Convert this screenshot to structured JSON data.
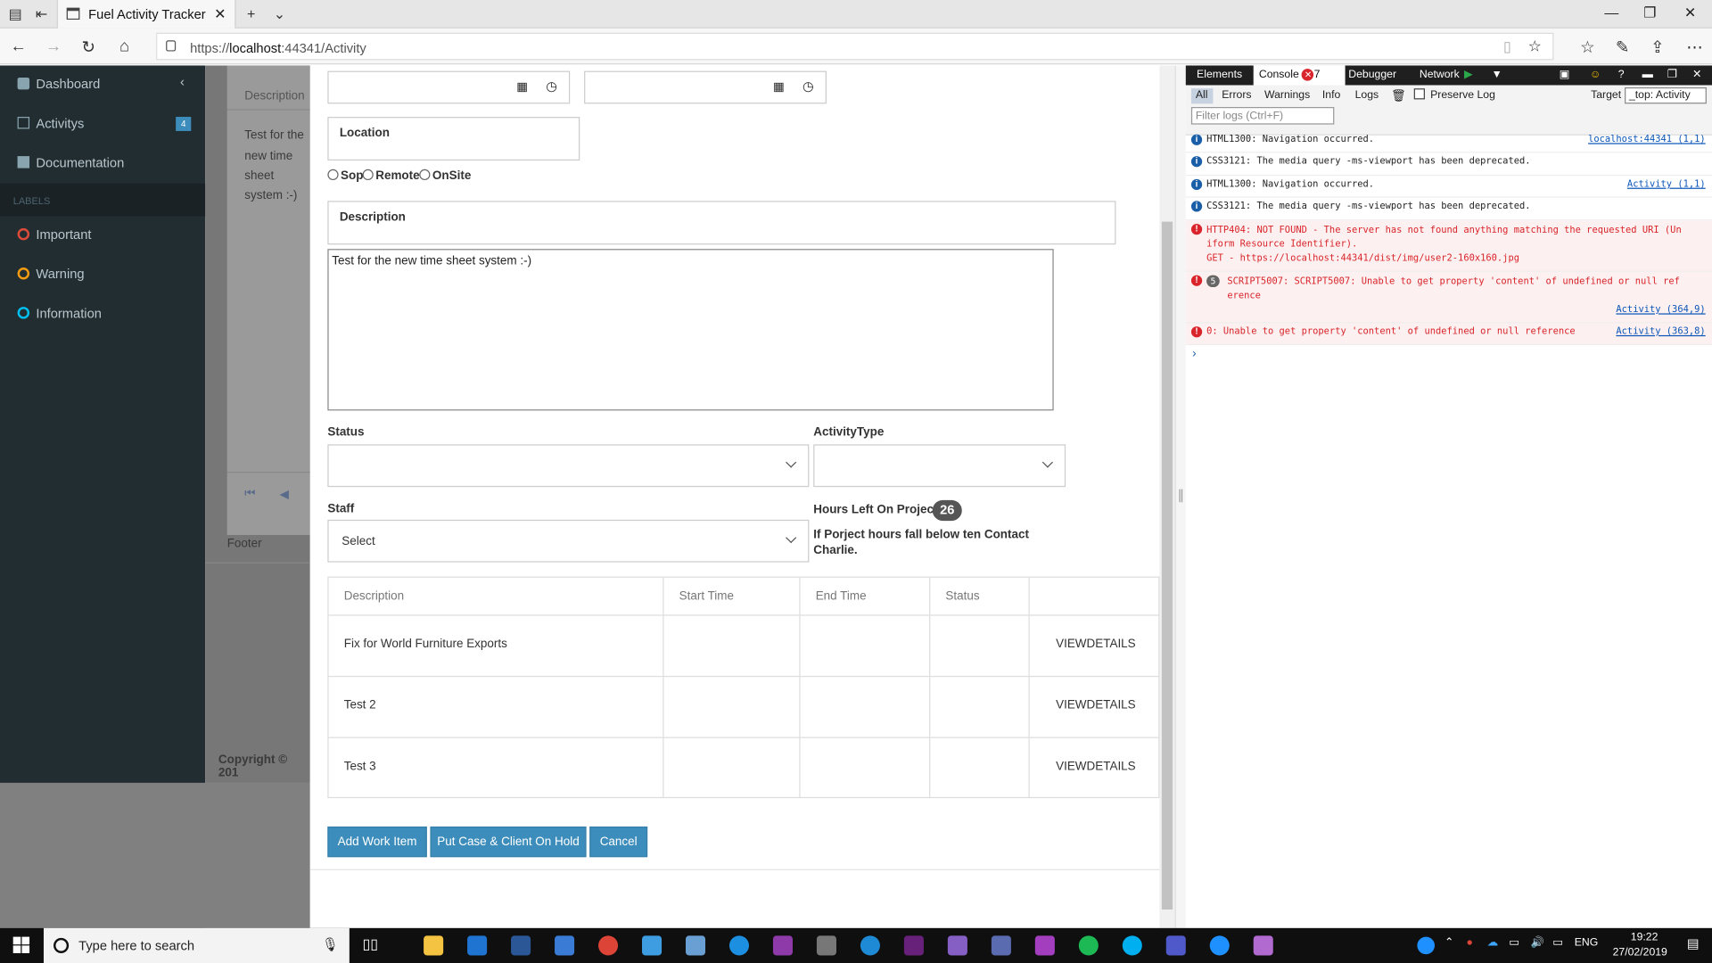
{
  "browser": {
    "tab_title": "Fuel Activity Tracker",
    "url_prefix": "https://",
    "url_host": "localhost",
    "url_rest": ":44341/Activity"
  },
  "sidebar": {
    "items": [
      {
        "label": "Dashboard"
      },
      {
        "label": "Activitys",
        "badge": "4"
      },
      {
        "label": "Documentation"
      }
    ],
    "labels_header": "LABELS",
    "labels": [
      {
        "label": "Important",
        "color": "#dd4b39"
      },
      {
        "label": "Warning",
        "color": "#f39c12"
      },
      {
        "label": "Information",
        "color": "#00c0ef"
      }
    ]
  },
  "background_page": {
    "description_header": "Description",
    "description_text": [
      "Test for the",
      "new time",
      "sheet",
      "system :-)"
    ],
    "footer": "Footer",
    "copyright": "Copyright © 201"
  },
  "form": {
    "location_label": "Location",
    "location_options": [
      "Sop",
      "Remote",
      "OnSite"
    ],
    "description_label": "Description",
    "description_value": "Test for the new time sheet system :-)",
    "status_label": "Status",
    "activity_type_label": "ActivityType",
    "staff_label": "Staff",
    "staff_value": "Select",
    "hours_left_label": "Hours Left On Project",
    "hours_left_value": "26",
    "hours_warning": "If Porject hours fall below ten Contact Charlie."
  },
  "work_items_table": {
    "columns": [
      "Description",
      "Start Time",
      "End Time",
      "Status",
      ""
    ],
    "rows": [
      {
        "description": "Fix for World Furniture Exports",
        "start": "",
        "end": "",
        "status": "",
        "action": "VIEWDETAILS"
      },
      {
        "description": "Test 2",
        "start": "",
        "end": "",
        "status": "",
        "action": "VIEWDETAILS"
      },
      {
        "description": "Test 3",
        "start": "",
        "end": "",
        "status": "",
        "action": "VIEWDETAILS"
      }
    ]
  },
  "buttons": {
    "add_work_item": "Add Work Item",
    "hold": "Put Case & Client On Hold",
    "cancel": "Cancel"
  },
  "devtools": {
    "tabs": [
      "Elements",
      "Console",
      "Debugger",
      "Network"
    ],
    "console_error_count": "7",
    "filters": [
      "All",
      "Errors",
      "Warnings",
      "Info",
      "Logs"
    ],
    "preserve_log": "Preserve Log",
    "filter_placeholder": "Filter logs (Ctrl+F)",
    "target_label": "Target",
    "target_value": "_top: Activity",
    "logs": [
      {
        "type": "info",
        "text": "HTML1300: Navigation occurred.",
        "source": "localhost:44341 (1,1)"
      },
      {
        "type": "info",
        "text": "CSS3121: The media query -ms-viewport has been deprecated.",
        "source": ""
      },
      {
        "type": "info",
        "text": "HTML1300: Navigation occurred.",
        "source": "Activity (1,1)"
      },
      {
        "type": "info",
        "text": "CSS3121: The media query -ms-viewport has been deprecated.",
        "source": ""
      },
      {
        "type": "error",
        "text": "HTTP404: NOT FOUND - The server has not found anything matching the requested URI (Un\niform Resource Identifier).\nGET - https://localhost:44341/dist/img/user2-160x160.jpg",
        "source": ""
      },
      {
        "type": "error",
        "count": "5",
        "text": "SCRIPT5007: SCRIPT5007: Unable to get property 'content' of undefined or null ref\nerence",
        "source": "Activity (364,9)"
      },
      {
        "type": "error",
        "text": "0: Unable to get property 'content' of undefined or null reference",
        "source": "Activity (363,8)"
      }
    ]
  },
  "taskbar": {
    "search_placeholder": "Type here to search",
    "language": "ENG",
    "time": "19:22",
    "date": "27/02/2019"
  }
}
